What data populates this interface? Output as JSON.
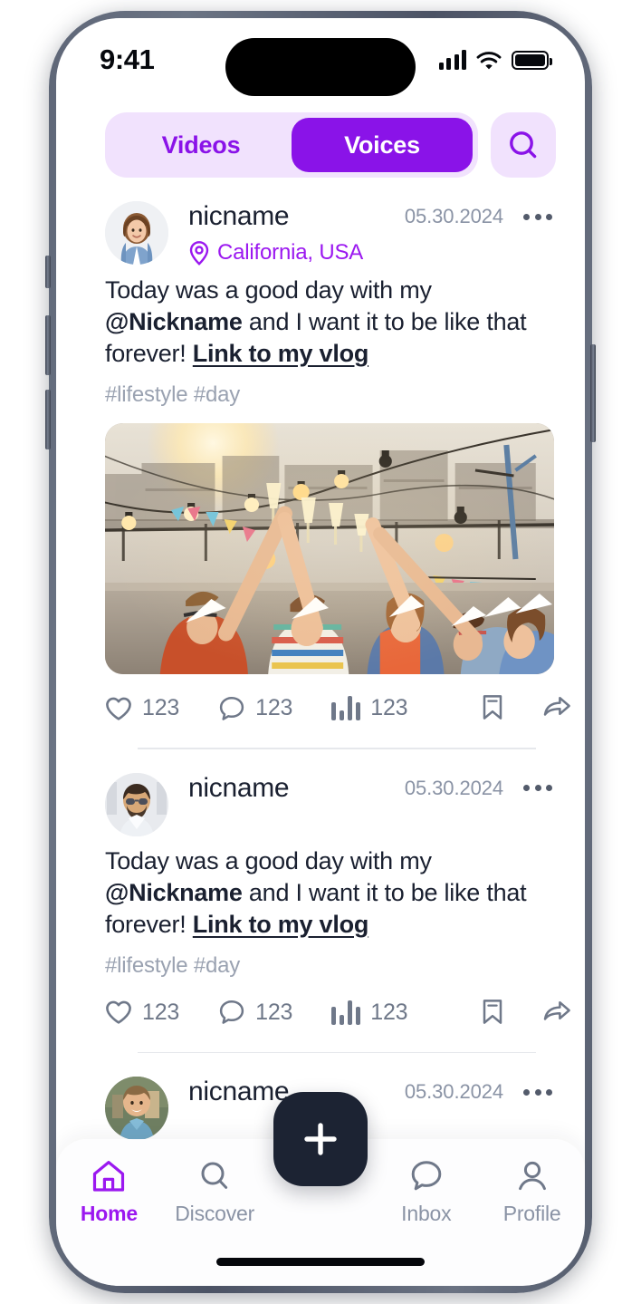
{
  "status_bar": {
    "time": "9:41",
    "signal_icon": "cellular-bars-icon",
    "wifi_icon": "wifi-icon",
    "battery_icon": "battery-icon"
  },
  "header": {
    "tabs": [
      {
        "label": "Videos",
        "active": false
      },
      {
        "label": "Voices",
        "active": true
      }
    ],
    "search_icon": "search-icon"
  },
  "colors": {
    "accent_purple": "#8A13E8",
    "accent_purple_light": "#9B18F0",
    "pill_background": "#F1E2FD",
    "text_dark": "#1A2030",
    "text_muted": "#8A93A5",
    "icon_grey": "#6F7889",
    "fab_dark": "#1C2333"
  },
  "feed": {
    "posts": [
      {
        "avatar": "woman-avatar",
        "nickname": "nicname",
        "date": "05.30.2024",
        "menu_icon": "more-options-icon",
        "location": "California, USA",
        "location_icon": "location-pin-icon",
        "body_1": "Today was a good day with my ",
        "body_mention": "@Nickname",
        "body_2": " and I want it to be like that forever! ",
        "body_link": "Link to my vlog",
        "tags": "#lifestyle  #day",
        "has_photo": true,
        "photo_alt": "rooftop-party-photo",
        "actions": {
          "like_icon": "heart-icon",
          "likes": "123",
          "comment_icon": "comment-icon",
          "comments": "123",
          "stats_icon": "audio-bars-icon",
          "stats": "123",
          "bookmark_icon": "bookmark-icon",
          "share_icon": "share-icon"
        }
      },
      {
        "avatar": "man-sunglasses-avatar",
        "nickname": "nicname",
        "date": "05.30.2024",
        "menu_icon": "more-options-icon",
        "location": null,
        "location_icon": null,
        "body_1": "Today was a good day with my ",
        "body_mention": "@Nickname",
        "body_2": " and I want it to be like that forever! ",
        "body_link": "Link to my vlog",
        "tags": "#lifestyle  #day",
        "has_photo": false,
        "photo_alt": null,
        "actions": {
          "like_icon": "heart-icon",
          "likes": "123",
          "comment_icon": "comment-icon",
          "comments": "123",
          "stats_icon": "audio-bars-icon",
          "stats": "123",
          "bookmark_icon": "bookmark-icon",
          "share_icon": "share-icon"
        }
      },
      {
        "avatar": "man-smiling-avatar",
        "nickname": "nicname",
        "date": "05.30.2024",
        "menu_icon": "more-options-icon",
        "location": null,
        "location_icon": null,
        "body_1": "",
        "body_mention": "",
        "body_2": "",
        "body_link": "",
        "tags": "",
        "has_photo": false,
        "photo_alt": null,
        "actions": null
      }
    ]
  },
  "bottom_nav": {
    "items": [
      {
        "label": "Home",
        "icon": "home-icon",
        "active": true
      },
      {
        "label": "Discover",
        "icon": "search-icon",
        "active": false
      },
      {
        "label": "Inbox",
        "icon": "comment-icon",
        "active": false
      },
      {
        "label": "Profile",
        "icon": "person-icon",
        "active": false
      }
    ],
    "create_button_icon": "plus-icon"
  }
}
